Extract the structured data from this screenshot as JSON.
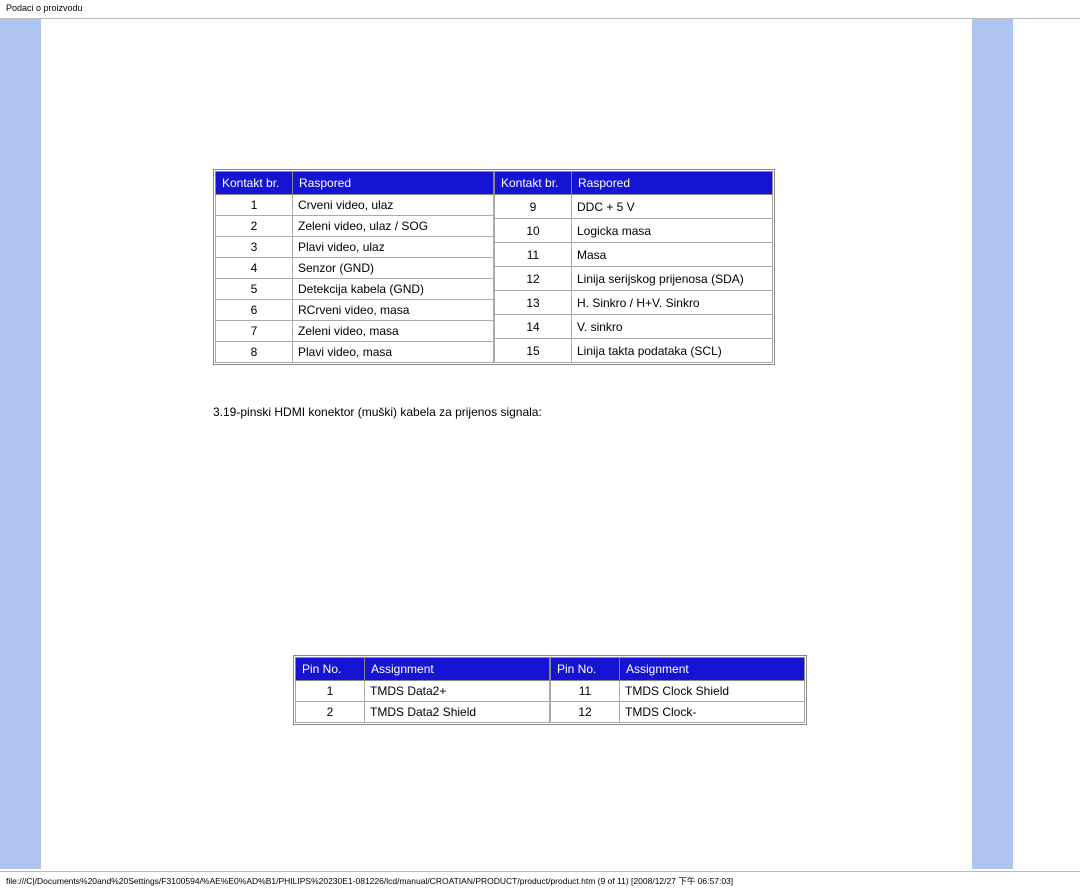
{
  "page_title": "Podaci o proizvodu",
  "vga": {
    "headers_left": {
      "col1": "Kontakt br.",
      "col2": "Raspored"
    },
    "headers_right": {
      "col1": "Kontakt br.",
      "col2": "Raspored"
    },
    "left_rows": [
      {
        "pin": "1",
        "desc": "Crveni video, ulaz"
      },
      {
        "pin": "2",
        "desc": "Zeleni video, ulaz / SOG"
      },
      {
        "pin": "3",
        "desc": "Plavi video, ulaz"
      },
      {
        "pin": "4",
        "desc": "Senzor (GND)"
      },
      {
        "pin": "5",
        "desc": "Detekcija kabela (GND)"
      },
      {
        "pin": "6",
        "desc": "RCrveni video, masa"
      },
      {
        "pin": "7",
        "desc": "Zeleni video, masa"
      },
      {
        "pin": "8",
        "desc": "Plavi video, masa"
      }
    ],
    "right_rows": [
      {
        "pin": "9",
        "desc": "DDC + 5 V"
      },
      {
        "pin": "10",
        "desc": "Logicka masa"
      },
      {
        "pin": "11",
        "desc": "Masa"
      },
      {
        "pin": "12",
        "desc": "Linija serijskog prijenosa (SDA)"
      },
      {
        "pin": "13",
        "desc": "H. Sinkro / H+V. Sinkro"
      },
      {
        "pin": "14",
        "desc": "V. sinkro"
      },
      {
        "pin": "15",
        "desc": "Linija takta podataka (SCL)"
      }
    ]
  },
  "hdmi_heading": "3.19-pinski HDMI konektor (muški) kabela za prijenos signala:",
  "hdmi": {
    "headers_left": {
      "col1": "Pin No.",
      "col2": "Assignment"
    },
    "headers_right": {
      "col1": "Pin No.",
      "col2": "Assignment"
    },
    "left_rows": [
      {
        "pin": "1",
        "desc": "TMDS Data2+"
      },
      {
        "pin": "2",
        "desc": "TMDS Data2 Shield"
      }
    ],
    "right_rows": [
      {
        "pin": "11",
        "desc": "TMDS Clock Shield"
      },
      {
        "pin": "12",
        "desc": "TMDS Clock-"
      }
    ]
  },
  "footer_path": "file:///C|/Documents%20and%20Settings/F3100594/%AE%E0%AD%B1/PHILIPS%20230E1-081226/lcd/manual/CROATIAN/PRODUCT/product/product.htm (9 of 11) [2008/12/27 下午 06:57:03]"
}
